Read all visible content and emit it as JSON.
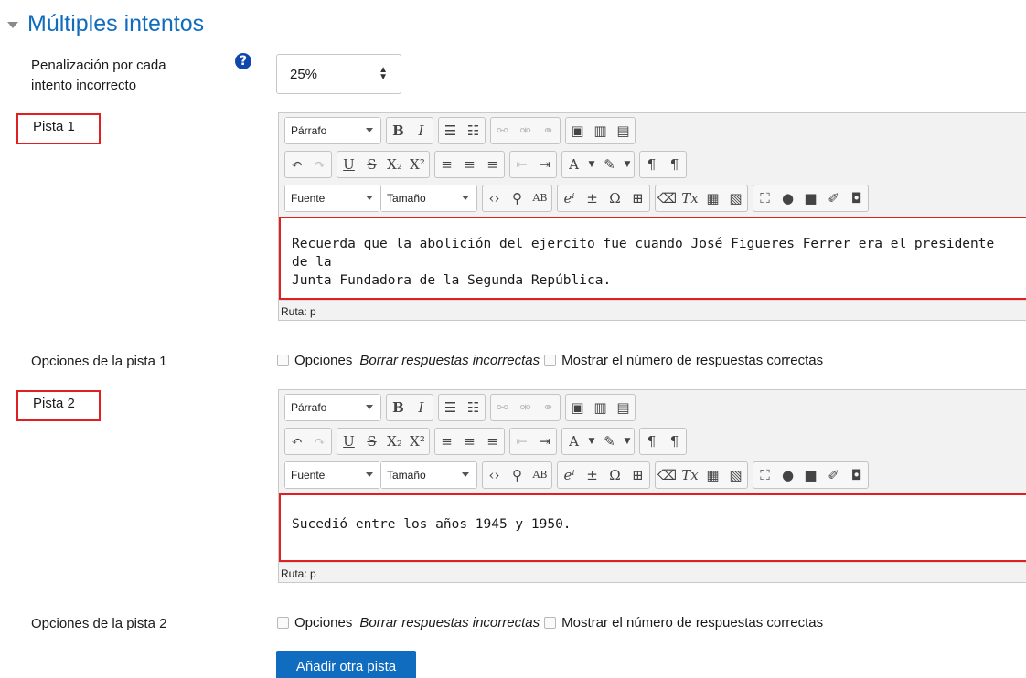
{
  "section": {
    "title": "Múltiples intentos"
  },
  "penalty": {
    "label_line1": "Penalización por cada",
    "label_line2": "intento incorrecto",
    "help_icon": "question-circle-icon",
    "value": "25%"
  },
  "editor_toolbar": {
    "paragraph": "Párrafo",
    "font": "Fuente",
    "size": "Tamaño",
    "path_label": "Ruta: p"
  },
  "hints": [
    {
      "label": "Pista 1",
      "text_line1": "Recuerda que la abolición del ejercito fue  cuando José Figueres Ferrer era el presidente de la",
      "text_line2": "Junta Fundadora de la Segunda República.",
      "options_label": "Opciones de la pista 1"
    },
    {
      "label": "Pista 2",
      "text_line1": "Sucedió entre los años 1945 y 1950.",
      "text_line2": "",
      "options_label": "Opciones de la pista 2"
    }
  ],
  "hint_options": {
    "options": "Opciones",
    "clear_wrong": "Borrar respuestas incorrectas",
    "show_correct": "Mostrar el número de respuestas correctas"
  },
  "add_hint_button": "Añadir otra pista",
  "colors": {
    "brand": "#0f6cbf",
    "highlight": "#e02020"
  }
}
